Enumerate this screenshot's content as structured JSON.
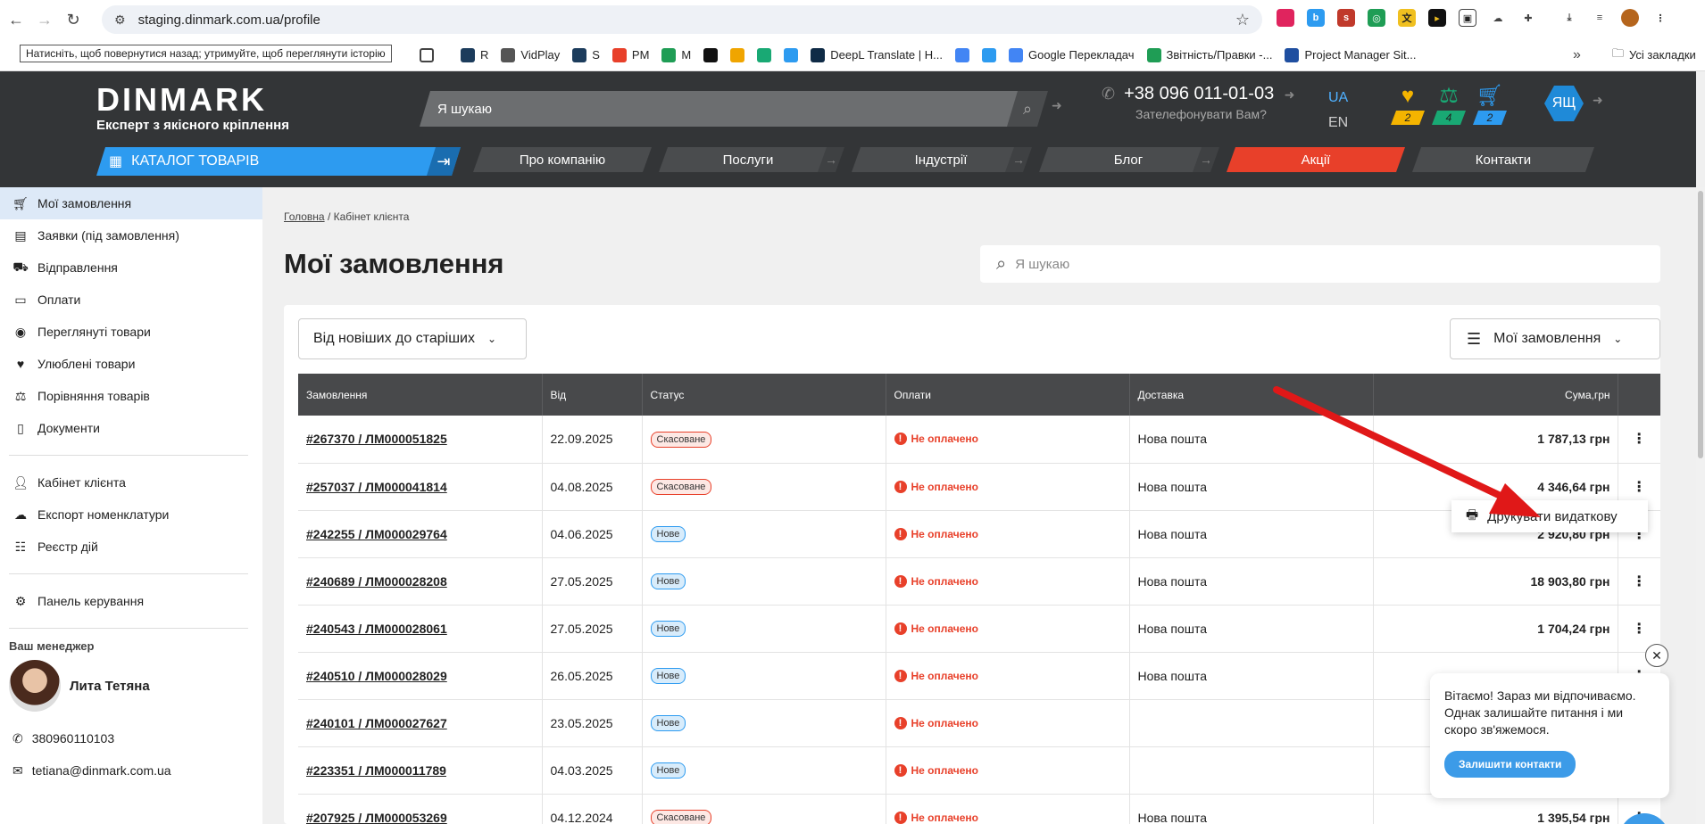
{
  "browser": {
    "url": "staging.dinmark.com.ua/profile",
    "tooltip": "Натисніть, щоб повернутися назад; утримуйте, щоб переглянути історію",
    "bookmarks": [
      {
        "label": "R",
        "color": "#1c3c5c"
      },
      {
        "label": "VidPlay",
        "color": "#555555"
      },
      {
        "label": "S",
        "color": "#1c3c5c"
      },
      {
        "label": "PM",
        "color": "#e8402a"
      },
      {
        "label": "M",
        "color": "#1f9d55"
      },
      {
        "label": "",
        "color": "#111111"
      },
      {
        "label": "",
        "color": "#f0a500"
      },
      {
        "label": "",
        "color": "#19a974"
      },
      {
        "label": "",
        "color": "#2d9bf0"
      },
      {
        "label": "DeepL Translate | H...",
        "color": "#0f2b46"
      },
      {
        "label": "",
        "color": "#4285f4"
      },
      {
        "label": "",
        "color": "#2d9bf0"
      },
      {
        "label": "Google Перекладач",
        "color": "#4285f4"
      },
      {
        "label": "Звітність/Правки -...",
        "color": "#1f9d55"
      },
      {
        "label": "Project Manager Sit...",
        "color": "#1f4fa0"
      }
    ],
    "all_bookmarks": "Усі закладки"
  },
  "header": {
    "brand": "DINMARK",
    "tagline": "Експерт з якісного кріплення",
    "search_placeholder": "Я шукаю",
    "phone": "+38 096 011-01-03",
    "callback": "Зателефонувати Вам?",
    "lang_ua": "UA",
    "lang_en": "EN",
    "favorites_count": "2",
    "compare_count": "4",
    "cart_count": "2",
    "user_initials": "ЯЩ",
    "catalog": "КАТАЛОГ ТОВАРІВ",
    "nav": [
      "Про компанію",
      "Послуги",
      "Індустрії",
      "Блог",
      "Акції",
      "Контакти"
    ]
  },
  "sidebar": {
    "items": [
      {
        "icon": "cart-icon",
        "label": "Мої замовлення"
      },
      {
        "icon": "list-icon",
        "label": "Заявки (під замовлення)"
      },
      {
        "icon": "truck-icon",
        "label": "Відправлення"
      },
      {
        "icon": "card-icon",
        "label": "Оплати"
      },
      {
        "icon": "eye-icon",
        "label": "Переглянуті товари"
      },
      {
        "icon": "heart-icon",
        "label": "Улюблені товари"
      },
      {
        "icon": "compare-icon",
        "label": "Порівняння товарів"
      },
      {
        "icon": "document-icon",
        "label": "Документи"
      }
    ],
    "items2": [
      {
        "icon": "user-icon",
        "label": "Кабінет клієнта"
      },
      {
        "icon": "cloud-download-icon",
        "label": "Експорт номенклатури"
      },
      {
        "icon": "registry-icon",
        "label": "Реєстр дій"
      }
    ],
    "items3": [
      {
        "icon": "user-gear-icon",
        "label": "Панель керування"
      }
    ],
    "manager_title": "Ваш менеджер",
    "manager_name": "Лита Тетяна",
    "phone": "380960110103",
    "email": "tetiana@dinmark.com.ua"
  },
  "main": {
    "breadcrumb_home": "Головна",
    "breadcrumb_sep": "/",
    "breadcrumb_current": "Кабінет клієнта",
    "title": "Мої замовлення",
    "search_placeholder": "Я шукаю",
    "sort_label": "Від новіших до старіших",
    "filter_label": "Мої замовлення",
    "columns": [
      "Замовлення",
      "Від",
      "Статус",
      "Оплати",
      "Доставка",
      "Сума,грн"
    ],
    "rows": [
      {
        "order": "#267370 / ЛМ000051825",
        "date": "22.09.2025",
        "status": "Скасоване",
        "status_type": "cancel",
        "payment": "Не оплачено",
        "delivery": "Нова пошта",
        "sum": "1 787,13 грн"
      },
      {
        "order": "#257037 / ЛМ000041814",
        "date": "04.08.2025",
        "status": "Скасоване",
        "status_type": "cancel",
        "payment": "Не оплачено",
        "delivery": "Нова пошта",
        "sum": "4 346,64 грн"
      },
      {
        "order": "#242255 / ЛМ000029764",
        "date": "04.06.2025",
        "status": "Нове",
        "status_type": "new",
        "payment": "Не оплачено",
        "delivery": "Нова пошта",
        "sum": "2 920,80 грн"
      },
      {
        "order": "#240689 / ЛМ000028208",
        "date": "27.05.2025",
        "status": "Нове",
        "status_type": "new",
        "payment": "Не оплачено",
        "delivery": "Нова пошта",
        "sum": "18 903,80 грн"
      },
      {
        "order": "#240543 / ЛМ000028061",
        "date": "27.05.2025",
        "status": "Нове",
        "status_type": "new",
        "payment": "Не оплачено",
        "delivery": "Нова пошта",
        "sum": "1 704,24 грн"
      },
      {
        "order": "#240510 / ЛМ000028029",
        "date": "26.05.2025",
        "status": "Нове",
        "status_type": "new",
        "payment": "Не оплачено",
        "delivery": "Нова пошта",
        "sum": ""
      },
      {
        "order": "#240101 / ЛМ000027627",
        "date": "23.05.2025",
        "status": "Нове",
        "status_type": "new",
        "payment": "Не оплачено",
        "delivery": "",
        "sum": ""
      },
      {
        "order": "#223351 / ЛМ000011789",
        "date": "04.03.2025",
        "status": "Нове",
        "status_type": "new",
        "payment": "Не оплачено",
        "delivery": "",
        "sum": ""
      },
      {
        "order": "#207925 / ЛМ000053269",
        "date": "04.12.2024",
        "status": "Скасоване",
        "status_type": "cancel",
        "payment": "Не оплачено",
        "delivery": "Нова пошта",
        "sum": "1 395,54 грн"
      }
    ],
    "dropdown_item": "Друкувати видаткову"
  },
  "chat": {
    "message": "Вітаємо! Зараз ми відпочиваємо. Однак залишайте питання і ми скоро зв'яжемося.",
    "button": "Залишити контакти"
  },
  "colors": {
    "accent": "#2d9bf0",
    "header_bg": "#333537",
    "promo": "#e8402a",
    "annotation_arrow": "#e01818"
  }
}
